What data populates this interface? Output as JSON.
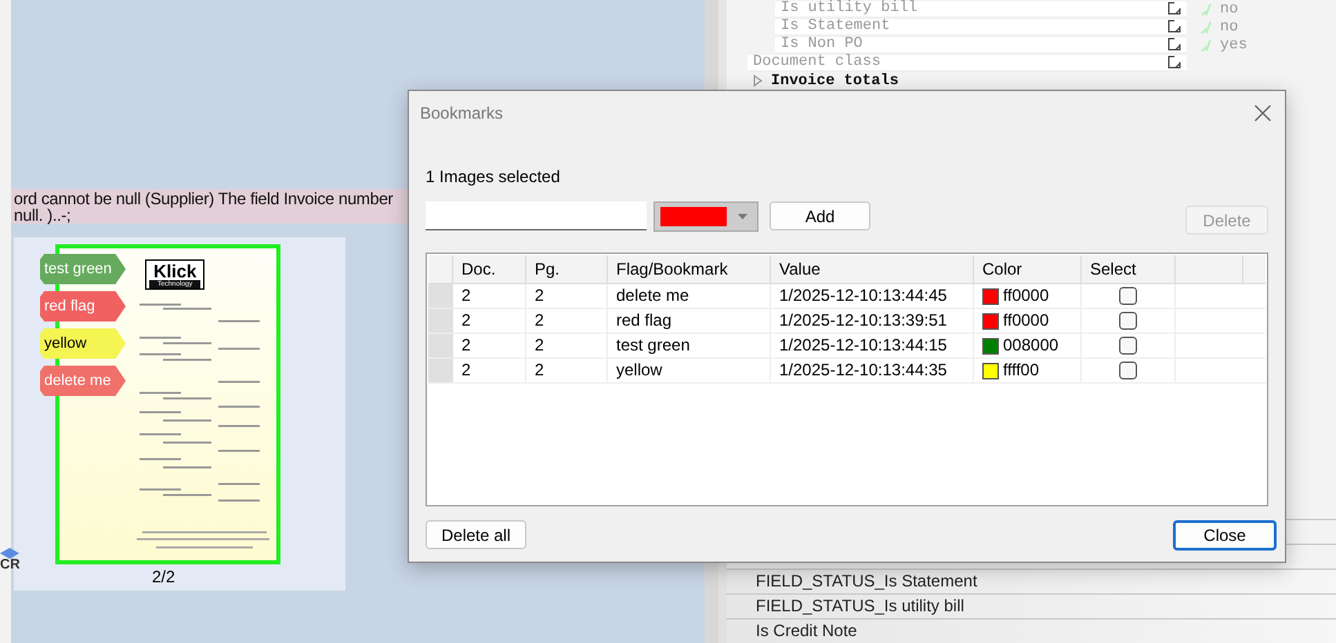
{
  "error_banner": {
    "lines": [
      "ord cannot be null (Supplier) The field Invoice number",
      "null. )..-;"
    ]
  },
  "side_label": "CR",
  "thumbnail": {
    "selected": true,
    "logo": "Klick",
    "logo_sub": "Technology",
    "page_label": "2/2",
    "flags": [
      {
        "label": "test green",
        "color": "#66aa5e"
      },
      {
        "label": "red flag",
        "color": "#f06262"
      },
      {
        "label": "yellow",
        "color": "#f4f452"
      },
      {
        "label": "delete me",
        "color": "#f0706a"
      }
    ]
  },
  "properties": {
    "rows": [
      {
        "kind": "child",
        "label": "Is utility bill",
        "value": "no"
      },
      {
        "kind": "child",
        "label": "Is Statement",
        "value": "no"
      },
      {
        "kind": "child",
        "label": "Is Non PO",
        "value": "yes"
      },
      {
        "kind": "field",
        "label": "Document class"
      },
      {
        "kind": "group",
        "label": "Invoice totals"
      }
    ]
  },
  "field_list": [
    "FIELD_STATUS_Is Statement",
    "FIELD_STATUS_Is utility bill",
    "Is Credit Note"
  ],
  "dialog": {
    "title": "Bookmarks",
    "selection_info": "1 Images selected",
    "color_picker": {
      "color": "#ff0000"
    },
    "buttons": [
      {
        "label": "Add",
        "disabled": false,
        "default": false
      },
      {
        "label": "Delete",
        "disabled": true,
        "default": false
      },
      {
        "label": "Delete all",
        "disabled": false,
        "default": false
      },
      {
        "label": "Close",
        "disabled": false,
        "default": true
      }
    ],
    "table": {
      "columns": [
        "Doc.",
        "Pg.",
        "Flag/Bookmark",
        "Value",
        "Color",
        "Select"
      ],
      "rows": [
        {
          "doc": "2",
          "page": "2",
          "flag": "delete me",
          "value": "1/2025-12-10:13:44:45",
          "color": "#ff0000",
          "color_code": "ff0000",
          "checked": false
        },
        {
          "doc": "2",
          "page": "2",
          "flag": "red flag",
          "value": "1/2025-12-10:13:39:51",
          "color": "#ff0000",
          "color_code": "ff0000",
          "checked": false
        },
        {
          "doc": "2",
          "page": "2",
          "flag": "test green",
          "value": "1/2025-12-10:13:44:15",
          "color": "#008000",
          "color_code": "008000",
          "checked": false
        },
        {
          "doc": "2",
          "page": "2",
          "flag": "yellow",
          "value": "1/2025-12-10:13:44:35",
          "color": "#ffff00",
          "color_code": "ffff00",
          "checked": false
        }
      ]
    }
  }
}
